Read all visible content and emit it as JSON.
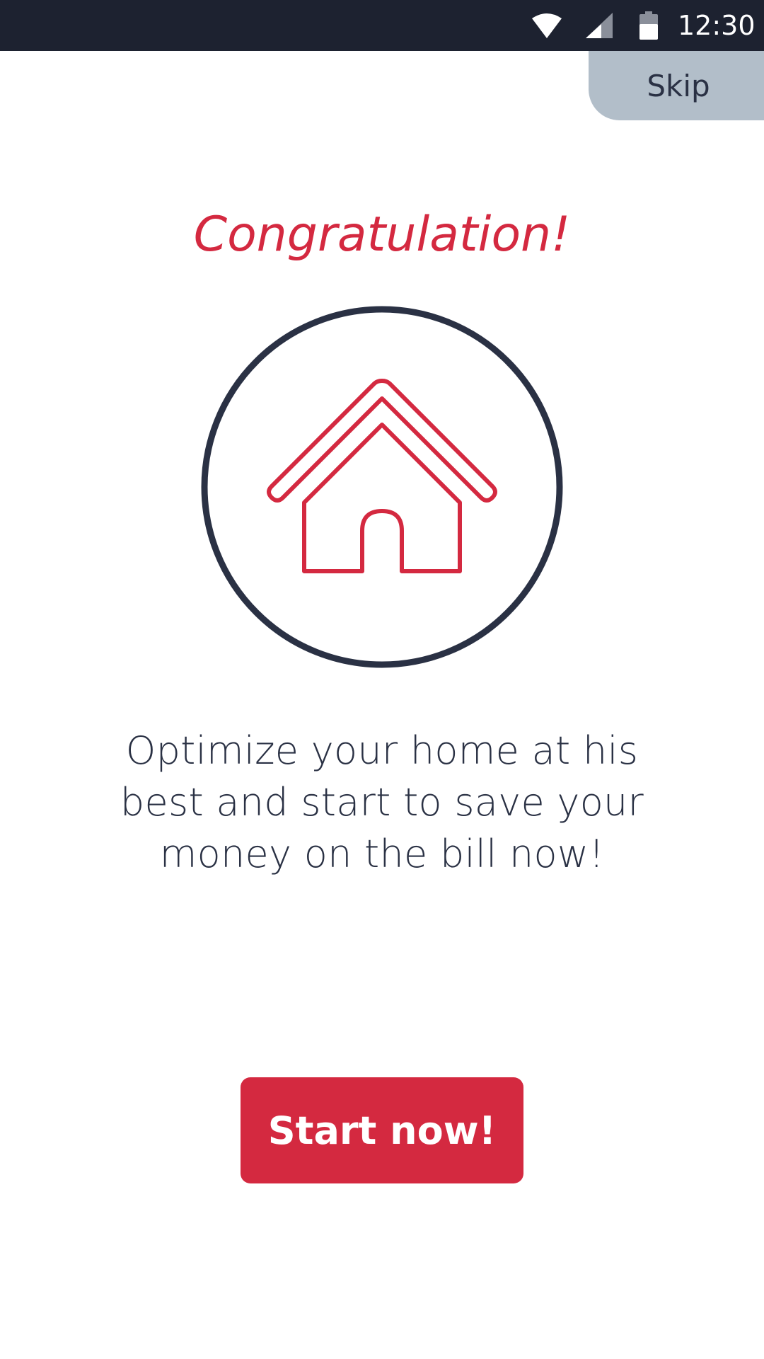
{
  "status_bar": {
    "time": "12:30",
    "icons": [
      "wifi-icon",
      "cellular-signal-icon",
      "battery-icon"
    ]
  },
  "skip_label": "Skip",
  "title": "Congratulation!",
  "illustration": {
    "icon": "house-icon",
    "frame": "circle"
  },
  "message_lines": [
    "Optimize your home at his",
    "best and start to save your",
    "money on the bill now!"
  ],
  "cta_label": "Start now!",
  "colors": {
    "status_bar": "#1d2230",
    "accent": "#d42940",
    "text": "#2a3144",
    "skip_bg": "#b2bec9",
    "circle_stroke": "#2a3144"
  }
}
